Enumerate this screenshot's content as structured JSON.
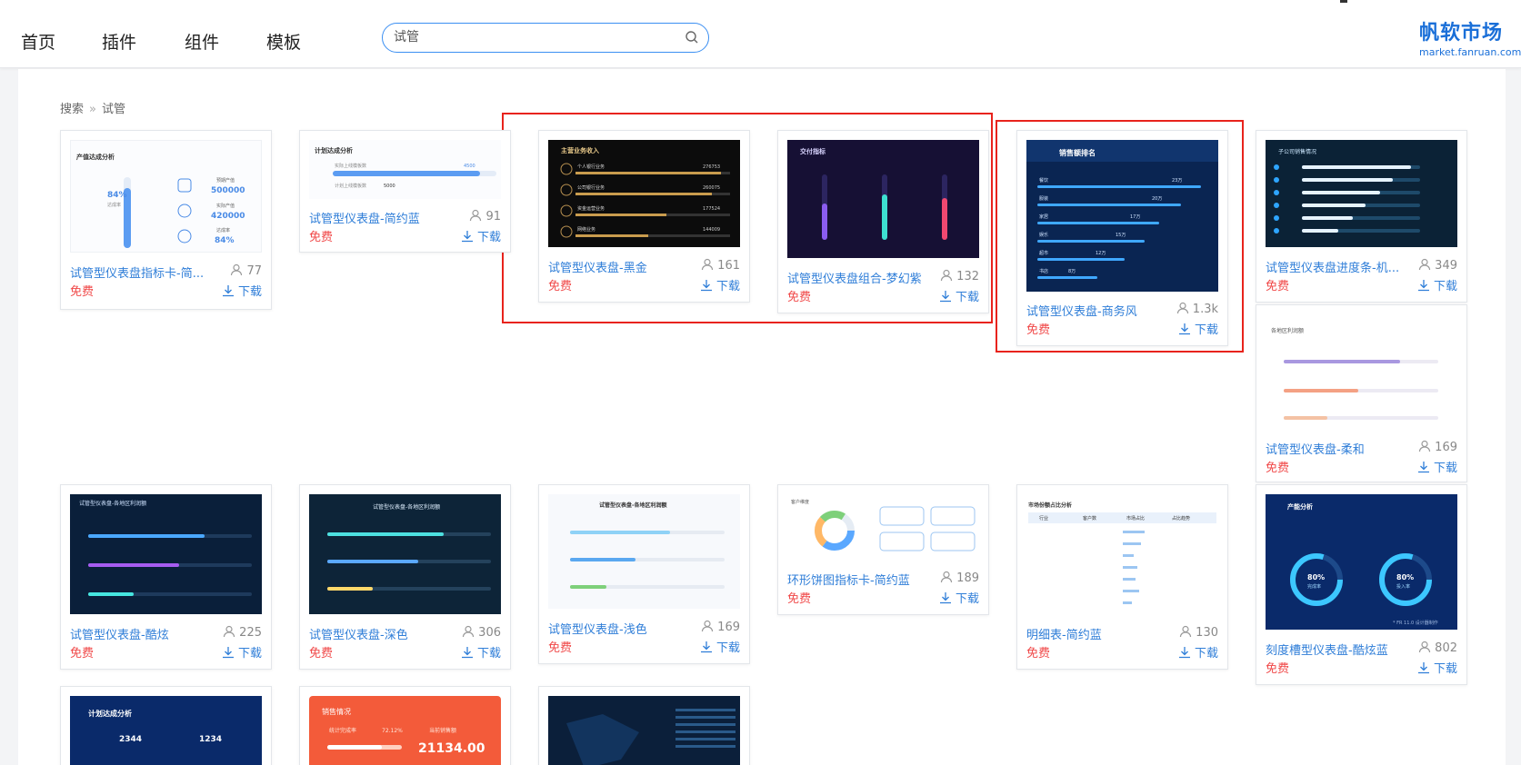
{
  "nav": {
    "items": [
      "首页",
      "插件",
      "组件",
      "模板"
    ]
  },
  "search": {
    "value": "试管"
  },
  "logo": {
    "cn": "帆软市场",
    "en": "market.fanruan.com"
  },
  "breadcrumb": {
    "root": "搜索",
    "sep": "»",
    "current": "试管"
  },
  "thumb_texts": {
    "c1": {
      "title": "产值达成分析",
      "pct": "84%",
      "pct_label": "达成率",
      "m1_label": "预期产值",
      "m1": "500000",
      "m2_label": "实际产值",
      "m2": "420000",
      "m3_label": "达成率",
      "m3": "84%"
    },
    "c2": {
      "title": "计划达成分析",
      "r1": "实际上线模板数",
      "r1v": "4500",
      "r2": "计划上线模板数",
      "r2v": "5000"
    },
    "c3": {
      "title": "主营业务收入",
      "rows": [
        "个人银行业务",
        "公司银行业务",
        "资金运营业务",
        "网络业务"
      ],
      "vals": [
        "276753",
        "260075",
        "177524",
        "144009"
      ]
    },
    "c4": {
      "title": "交付指标"
    },
    "c5": {
      "title": "销售额排名",
      "rows": [
        "餐饮",
        "服装",
        "家居",
        "娱乐",
        "超市",
        "书店"
      ],
      "vals": [
        "23万",
        "20万",
        "17万",
        "15万",
        "12万",
        "8万"
      ]
    },
    "c6": {
      "title": "子公司销售情况"
    },
    "c7": {
      "title": "各地区利润额"
    },
    "c8": {
      "title": "试管型仪表盘-各地区利润额"
    },
    "c9": {
      "title": "试管型仪表盘-各地区利润额"
    },
    "c10": {
      "title": "试管型仪表盘-各地区利润额"
    },
    "c11": {
      "title": "客户维度"
    },
    "c12": {
      "title": "市场份额占比分析",
      "cols": [
        "行业",
        "客户数",
        "市场占比",
        "占比趋势"
      ]
    },
    "c13": {
      "title": "产能分析",
      "v1": "80%",
      "v1l": "完成率",
      "v2": "80%",
      "v2l": "投入率",
      "foot": "* FR 11.0 设计器制作"
    },
    "c14": {
      "title": "计划达成分析",
      "v1": "2344",
      "v2": "1234"
    },
    "c15": {
      "title": "销售情况",
      "l1": "统计完成率",
      "l1v": "72.12%",
      "l2": "当前销售额",
      "big": "21134.00"
    }
  },
  "cards": [
    {
      "title": "试管型仪表盘指标卡-简...",
      "users": "77",
      "free": "免费",
      "download": "下载"
    },
    {
      "title": "试管型仪表盘-简约蓝",
      "users": "91",
      "free": "免费",
      "download": "下载"
    },
    {
      "title": "试管型仪表盘-黑金",
      "users": "161",
      "free": "免费",
      "download": "下载"
    },
    {
      "title": "试管型仪表盘组合-梦幻紫",
      "users": "132",
      "free": "免费",
      "download": "下载"
    },
    {
      "title": "试管型仪表盘-商务风",
      "users": "1.3k",
      "free": "免费",
      "download": "下载"
    },
    {
      "title": "试管型仪表盘进度条-机...",
      "users": "349",
      "free": "免费",
      "download": "下载"
    },
    {
      "title": "试管型仪表盘-柔和",
      "users": "169",
      "free": "免费",
      "download": "下载"
    },
    {
      "title": "试管型仪表盘-酷炫",
      "users": "225",
      "free": "免费",
      "download": "下载"
    },
    {
      "title": "试管型仪表盘-深色",
      "users": "306",
      "free": "免费",
      "download": "下载"
    },
    {
      "title": "试管型仪表盘-浅色",
      "users": "169",
      "free": "免费",
      "download": "下载"
    },
    {
      "title": "环形饼图指标卡-简约蓝",
      "users": "189",
      "free": "免费",
      "download": "下载"
    },
    {
      "title": "明细表-简约蓝",
      "users": "130",
      "free": "免费",
      "download": "下载"
    },
    {
      "title": "刻度槽型仪表盘-酷炫蓝",
      "users": "802",
      "free": "免费",
      "download": "下载"
    }
  ]
}
